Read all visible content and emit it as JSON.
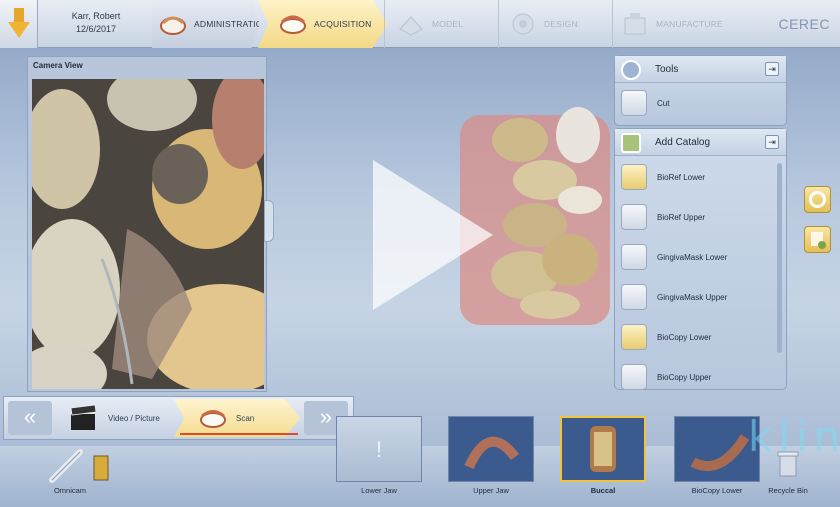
{
  "header": {
    "patient_name": "Karr, Robert",
    "date": "12/6/2017",
    "brand": "CEREC",
    "steps": [
      {
        "label": "ADMINISTRATION",
        "state": "done"
      },
      {
        "label": "ACQUISITION",
        "state": "active"
      },
      {
        "label": "MODEL",
        "state": "disabled"
      },
      {
        "label": "DESIGN",
        "state": "disabled"
      },
      {
        "label": "MANUFACTURE",
        "state": "disabled"
      }
    ]
  },
  "camera": {
    "title": "Camera View"
  },
  "tools": {
    "title": "Tools",
    "items": [
      {
        "label": "Cut",
        "icon": "cut-icon"
      }
    ]
  },
  "catalog": {
    "title": "Add Catalog",
    "items": [
      {
        "label": "BioRef Lower",
        "icon": "lower-jaw-icon"
      },
      {
        "label": "BioRef Upper",
        "icon": "upper-jaw-icon"
      },
      {
        "label": "GingivaMask Lower",
        "icon": "gingiva-lower-icon"
      },
      {
        "label": "GingivaMask Upper",
        "icon": "gingiva-upper-icon"
      },
      {
        "label": "BioCopy Lower",
        "icon": "biocopy-lower-icon"
      },
      {
        "label": "BioCopy Upper",
        "icon": "biocopy-upper-icon"
      }
    ]
  },
  "subbar": {
    "video_label": "Video / Picture",
    "scan_label": "Scan"
  },
  "bottom": {
    "omnicam_label": "Omnicam",
    "catalogs": [
      {
        "label": "Lower Jaw",
        "state": "empty"
      },
      {
        "label": "Upper Jaw",
        "state": "filled"
      },
      {
        "label": "Buccal",
        "state": "selected"
      },
      {
        "label": "BioCopy Lower",
        "state": "filled"
      }
    ],
    "recycle_label": "Recycle Bin"
  },
  "watermark": "klin",
  "colors": {
    "accent": "#f3c43b",
    "active_step": "#f2d985",
    "scan_underline": "#e04a25"
  }
}
